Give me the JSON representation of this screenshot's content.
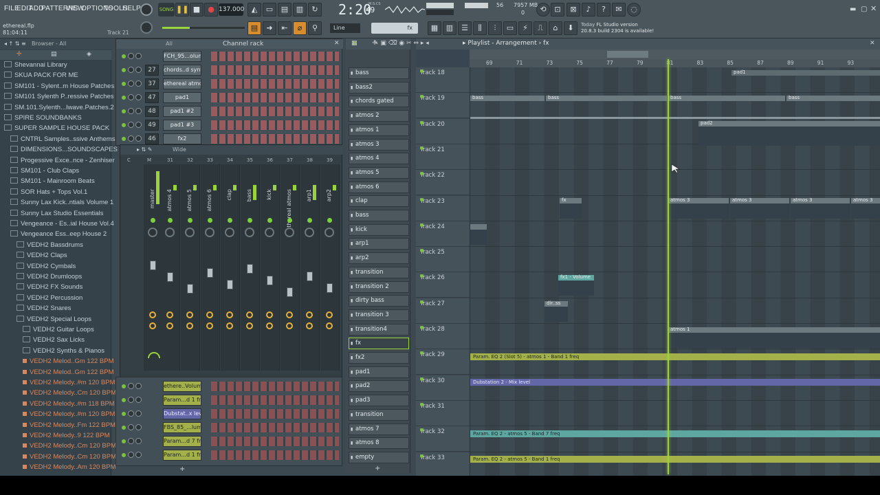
{
  "menu": [
    "FILE",
    "EDIT",
    "ADD",
    "PATTERNS",
    "VIEW",
    "OPTIONS",
    "TOOLS",
    "HELP"
  ],
  "transport": {
    "mode": "SONG",
    "tempo": "137.000",
    "time": "2:20",
    "time_sub": "49",
    "time_label": "M:S:CS",
    "cpu": "56",
    "memory": "7957 MB",
    "mem_sub": "0"
  },
  "project": {
    "file": "ethereal.flp",
    "position": "81:04:11",
    "track": "Track 21"
  },
  "snap": {
    "mode": "Line"
  },
  "news": {
    "line1": "Today",
    "line1b": "FL Studio version",
    "line2": "20.8.3 build 2304 is available!"
  },
  "browser": {
    "header": "Browser - All",
    "items": [
      {
        "label": "Shevannai Library",
        "type": "folder",
        "indent": 0
      },
      {
        "label": "SKUA PACK FOR ME",
        "type": "folder",
        "indent": 0
      },
      {
        "label": "SM101 - Sylent..m House Patches",
        "type": "folder",
        "indent": 0
      },
      {
        "label": "SM101 Sylenth P..ressive Patches",
        "type": "folder",
        "indent": 0
      },
      {
        "label": "SM.101.Sylenth...Iwave.Patches.2",
        "type": "folder",
        "indent": 0
      },
      {
        "label": "SPIRE SOUNDBANKS",
        "type": "folder",
        "indent": 0
      },
      {
        "label": "SUPER SAMPLE HOUSE PACK",
        "type": "folder",
        "indent": 0
      },
      {
        "label": "CNTRL Samples..ssive Anthems",
        "type": "folder",
        "indent": 1
      },
      {
        "label": "DIMENSIONS...SOUNDSCAPES",
        "type": "folder",
        "indent": 1
      },
      {
        "label": "Progessive Exce..nce - Zenhiser",
        "type": "folder",
        "indent": 1
      },
      {
        "label": "SM101 - Club Claps",
        "type": "folder",
        "indent": 1
      },
      {
        "label": "SM101 - Mainroom Beats",
        "type": "folder",
        "indent": 1
      },
      {
        "label": "SOR Hats + Tops Vol.1",
        "type": "folder",
        "indent": 1
      },
      {
        "label": "Sunny Lax Kick..ntials Volume 1",
        "type": "folder",
        "indent": 1
      },
      {
        "label": "Sunny Lax Studio Essentials",
        "type": "folder",
        "indent": 1
      },
      {
        "label": "Vengeance - Es..ial House Vol.4",
        "type": "folder",
        "indent": 1
      },
      {
        "label": "Vengeance Ess..eep House 2",
        "type": "folder",
        "indent": 1
      },
      {
        "label": "VEDH2 Bassdrums",
        "type": "folder",
        "indent": 2
      },
      {
        "label": "VEDH2 Claps",
        "type": "folder",
        "indent": 2
      },
      {
        "label": "VEDH2 Cymbals",
        "type": "folder",
        "indent": 2
      },
      {
        "label": "VEDH2 Drumloops",
        "type": "folder",
        "indent": 2
      },
      {
        "label": "VEDH2 FX Sounds",
        "type": "folder",
        "indent": 2
      },
      {
        "label": "VEDH2 Percussion",
        "type": "folder",
        "indent": 2
      },
      {
        "label": "VEDH2 Snares",
        "type": "folder",
        "indent": 2
      },
      {
        "label": "VEDH2 Special Loops",
        "type": "folder",
        "indent": 2
      },
      {
        "label": "VEDH2 Guitar Loops",
        "type": "folder",
        "indent": 3
      },
      {
        "label": "VEDH2 Sax Licks",
        "type": "folder",
        "indent": 3
      },
      {
        "label": "VEDH2 Synths & Pianos",
        "type": "folder",
        "indent": 3
      },
      {
        "label": "VEDH2 Melod..Gm 122 BPM",
        "type": "audio",
        "indent": 3
      },
      {
        "label": "VEDH2 Melod..Gm 122 BPM",
        "type": "audio",
        "indent": 3
      },
      {
        "label": "VEDH2 Melody..#m 120 BPM",
        "type": "audio",
        "indent": 3
      },
      {
        "label": "VEDH2 Melody..Cm 120 BPM",
        "type": "audio",
        "indent": 3
      },
      {
        "label": "VEDH2 Melody..#m 118 BPM",
        "type": "audio",
        "indent": 3
      },
      {
        "label": "VEDH2 Melody..#m 120 BPM",
        "type": "audio",
        "indent": 3
      },
      {
        "label": "VEDH2 Melody..Fm 122 BPM",
        "type": "audio",
        "indent": 3
      },
      {
        "label": "VEDH2 Melody..9 122 BPM",
        "type": "audio",
        "indent": 3
      },
      {
        "label": "VEDH2 Melody..Cm 120 BPM",
        "type": "audio",
        "indent": 3
      },
      {
        "label": "VEDH2 Melody..Cm 120 BPM",
        "type": "audio",
        "indent": 3
      },
      {
        "label": "VEDH2 Melody..Am 120 BPM",
        "type": "audio",
        "indent": 3
      }
    ]
  },
  "channel_rack": {
    "title": "Channel rack",
    "filter": "All",
    "rows": [
      {
        "num": "",
        "name": "FCH_95...olume"
      },
      {
        "num": "27",
        "name": "chords..d synth"
      },
      {
        "num": "37",
        "name": "ethereal atmos"
      },
      {
        "num": "47",
        "name": "pad1"
      },
      {
        "num": "48",
        "name": "pad1 #2"
      },
      {
        "num": "49",
        "name": "pad1 #3"
      },
      {
        "num": "46",
        "name": "fx2"
      }
    ],
    "rows2": [
      {
        "name": "ethere..Volume"
      },
      {
        "name": "Param...d 1 freq"
      },
      {
        "name": "Dubstat..x level"
      },
      {
        "name": "FBS_85_...lume"
      },
      {
        "name": "Param...d 7 freq"
      },
      {
        "name": "Param...d 1 freq"
      }
    ]
  },
  "mixer": {
    "view": "Wide",
    "strips": [
      "master",
      "atmos 4",
      "atmos 5",
      "atmos 6",
      "clap",
      "bass",
      "kick",
      "ethereal atmos",
      "arp1",
      "arp2"
    ],
    "header_nums": [
      "C",
      "M",
      "31",
      "32",
      "33",
      "34",
      "35",
      "36",
      "37",
      "38",
      "39"
    ]
  },
  "patterns": [
    "bass",
    "bass2",
    "chords gated",
    "atmos 2",
    "atmos 1",
    "atmos 3",
    "atmos 4",
    "atmos 5",
    "atmos 6",
    "clap",
    "bass",
    "kick",
    "arp1",
    "arp2",
    "transition",
    "transition 2",
    "dirty bass",
    "transition 3",
    "transition4",
    "fx",
    "fx2",
    "pad1",
    "pad2",
    "pad3",
    "transition",
    "atmos 7",
    "atmos 8",
    "empty"
  ],
  "playlist": {
    "title": "Playlist - Arrangement",
    "pattern": "fx",
    "ruler": [
      "69",
      "71",
      "73",
      "75",
      "77",
      "79",
      "81",
      "83",
      "85",
      "87",
      "89",
      "91",
      "93"
    ],
    "tracks": [
      "Track 18",
      "Track 19",
      "Track 20",
      "Track 21",
      "Track 22",
      "Track 23",
      "Track 24",
      "Track 25",
      "Track 26",
      "Track 27",
      "Track 28",
      "Track 29",
      "Track 30",
      "Track 31",
      "Track 32",
      "Track 33"
    ],
    "clips": {
      "pad1": "pad1",
      "bass": "bass",
      "pad2": "pad2",
      "fx": "fx",
      "atmos3": "atmos 3",
      "fx1vol": "fx1 - Volume",
      "dirss": "dir..ss",
      "atmos1": "atmos 1",
      "auto29": "Param. EQ 2 (Slot 5) - atmos 1 - Band 1 freq",
      "auto30": "Dubstation 2 - Mix level",
      "auto32": "Param. EQ 2 - atmos 5 - Band 7 freq",
      "auto33": "Param. EQ 2 - atmos 5 - Band 1 freq"
    }
  },
  "colors": {
    "accent": "#9ad33b",
    "auto_yellow": "#a4b04a",
    "auto_purple": "#6367a8",
    "auto_teal": "#5ea7a0",
    "clip_gray": "#6c7a80"
  }
}
